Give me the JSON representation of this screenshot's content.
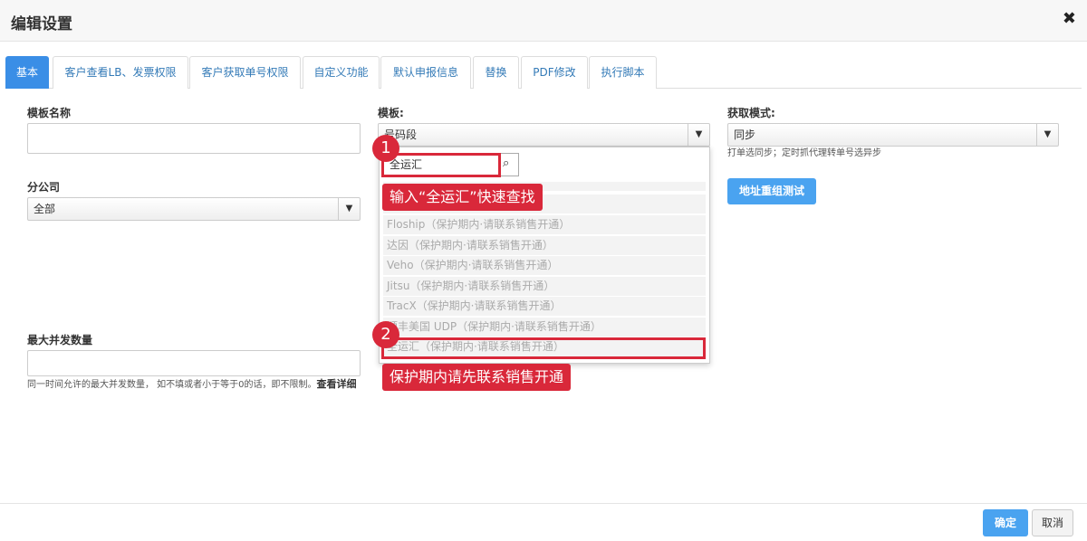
{
  "dialog": {
    "title": "编辑设置",
    "close": "✖"
  },
  "tabs": [
    "基本",
    "客户查看LB、发票权限",
    "客户获取单号权限",
    "自定义功能",
    "默认申报信息",
    "替换",
    "PDF修改",
    "执行脚本"
  ],
  "form": {
    "template_name_label": "模板名称",
    "template_name_value": "",
    "branch_label": "分公司",
    "branch_value": "全部",
    "max_concurrency_label": "最大并发数量",
    "max_concurrency_value": "",
    "max_concurrency_hint": "同一时间允许的最大并发数量， 如不填或者小于等于0的话，即不限制。",
    "max_concurrency_link": "查看详细",
    "template_label": "模板:",
    "template_value": "号码段",
    "fetch_mode_label": "获取模式:",
    "fetch_mode_value": "同步",
    "fetch_mode_hint": "打单选同步；定时抓代理转单号选异步",
    "address_test_button": "地址重组测试"
  },
  "dropdown": {
    "search_value": "全运汇",
    "options": [
      "Floship（保护期内·请联系销售开通）",
      "达因（保护期内·请联系销售开通）",
      "Veho（保护期内·请联系销售开通）",
      "Jitsu（保护期内·请联系销售开通）",
      "TracX（保护期内·请联系销售开通）",
      "顺丰美国 UDP（保护期内·请联系销售开通）",
      "全运汇（保护期内·请联系销售开通）"
    ]
  },
  "annotations": {
    "badge1": "1",
    "badge2": "2",
    "callout1": "输入“全运汇”快速查找",
    "callout2": "保护期内请先联系销售开通"
  },
  "footer": {
    "ok": "确定",
    "cancel": "取消"
  }
}
